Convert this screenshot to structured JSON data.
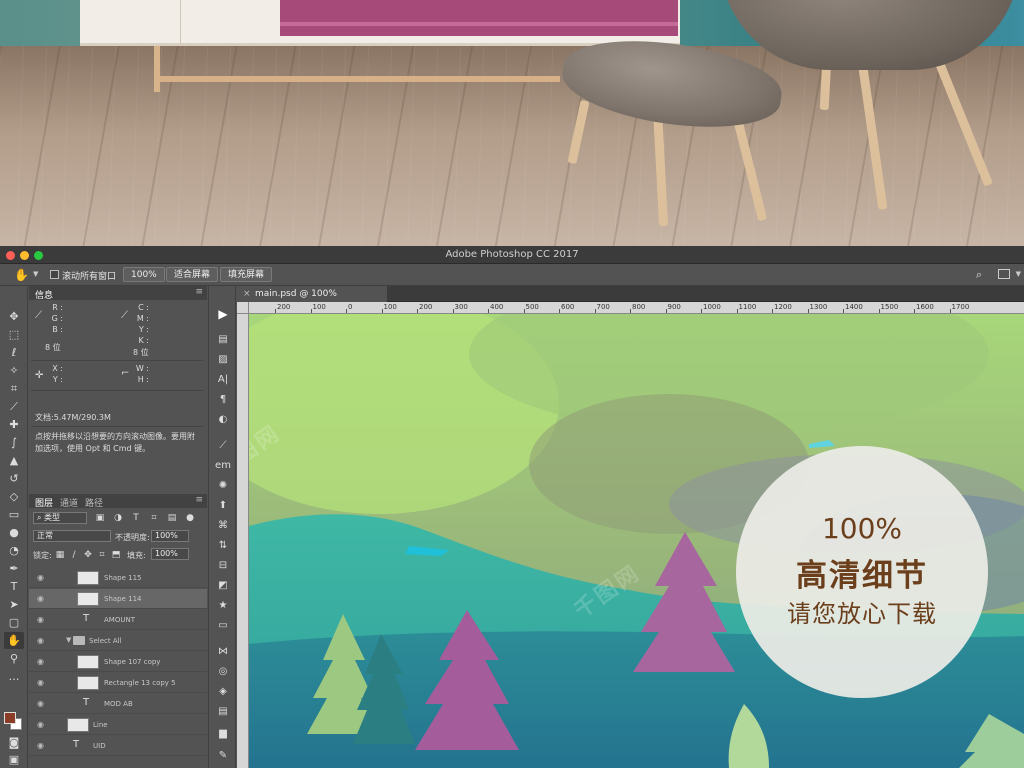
{
  "window": {
    "title": "Adobe Photoshop CC 2017"
  },
  "options_bar": {
    "scroll_all_label": "滚动所有窗口",
    "zoom_btn": "100%",
    "fit_screen_btn": "适合屏幕",
    "fill_screen_btn": "填充屏幕"
  },
  "info_panel": {
    "tab": "信息",
    "r": "R :",
    "g": "G :",
    "b": "B :",
    "c": "C :",
    "m": "M :",
    "y": "Y :",
    "k": "K :",
    "bits_left": "8 位",
    "bits_right": "8 位",
    "x": "X :",
    "y2": "Y :",
    "w": "W :",
    "h": "H :",
    "doc": "文档:5.47M/290.3M",
    "hint": "点按并拖移以沿想要的方向滚动图像。要用附加选项，使用 Opt 和 Cmd 键。"
  },
  "layers_panel": {
    "tabs": [
      "图层",
      "通道",
      "路径"
    ],
    "filter_kind": "类型",
    "blend_mode": "正常",
    "opacity_label": "不透明度:",
    "opacity": "100%",
    "lock_label": "锁定:",
    "fill_label": "填充:",
    "fill": "100%",
    "layers": [
      {
        "name": "Shape 115",
        "kind": "shape"
      },
      {
        "name": "Shape 114",
        "kind": "shape"
      },
      {
        "name": "AMOUNT",
        "kind": "text"
      },
      {
        "name": "Select All",
        "kind": "group"
      },
      {
        "name": "Shape 107 copy",
        "kind": "shape"
      },
      {
        "name": "Rectangle 13 copy 5",
        "kind": "shape"
      },
      {
        "name": "MOD AB",
        "kind": "text"
      },
      {
        "name": "Line",
        "kind": "shape"
      },
      {
        "name": "UID",
        "kind": "text"
      }
    ]
  },
  "document": {
    "tab_close": "×",
    "tab_title": "main.psd @ 100%",
    "ruler_ticks": [
      "200",
      "100",
      "0",
      "100",
      "200",
      "300",
      "400",
      "500",
      "600",
      "700",
      "800",
      "900",
      "1000",
      "1100",
      "1200",
      "1300",
      "1400",
      "1500",
      "1600",
      "1700"
    ]
  },
  "badge": {
    "line1": "100%",
    "line2": "高清细节",
    "line3": "请您放心下载"
  },
  "colors": {
    "accent_badge_text": "#6b3f1c",
    "foreground_swatch": "#8b3e25"
  }
}
